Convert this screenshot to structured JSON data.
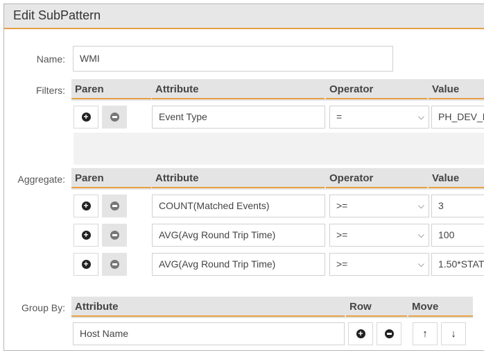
{
  "dialog": {
    "title": "Edit SubPattern"
  },
  "name": {
    "label": "Name:",
    "value": "WMI"
  },
  "filters": {
    "label": "Filters:",
    "headers": {
      "paren": "Paren",
      "attribute": "Attribute",
      "operator": "Operator",
      "value": "Value"
    },
    "rows": [
      {
        "attribute": "Event Type",
        "operator": "=",
        "value": "PH_DEV_M"
      }
    ]
  },
  "aggregate": {
    "label": "Aggregate:",
    "headers": {
      "paren": "Paren",
      "attribute": "Attribute",
      "operator": "Operator",
      "value": "Value"
    },
    "rows": [
      {
        "attribute": "COUNT(Matched Events)",
        "operator": ">=",
        "value": "3"
      },
      {
        "attribute": "AVG(Avg Round Trip Time)",
        "operator": ">=",
        "value": "100"
      },
      {
        "attribute": "AVG(Avg Round Trip Time)",
        "operator": ">=",
        "value": "1.50*STAT"
      }
    ]
  },
  "group_by": {
    "label": "Group By:",
    "headers": {
      "attribute": "Attribute",
      "row": "Row",
      "move": "Move"
    },
    "rows": [
      {
        "attribute": "Host Name"
      }
    ]
  },
  "icons": {
    "add": "plus-circle-icon",
    "remove": "minus-circle-icon",
    "dropdown": "chevron-down-icon",
    "up": "arrow-up-icon",
    "down": "arrow-down-icon"
  },
  "colors": {
    "accent": "#e8a043",
    "header_bg": "#e4e4e4",
    "title_bg": "#e7e7e7"
  }
}
